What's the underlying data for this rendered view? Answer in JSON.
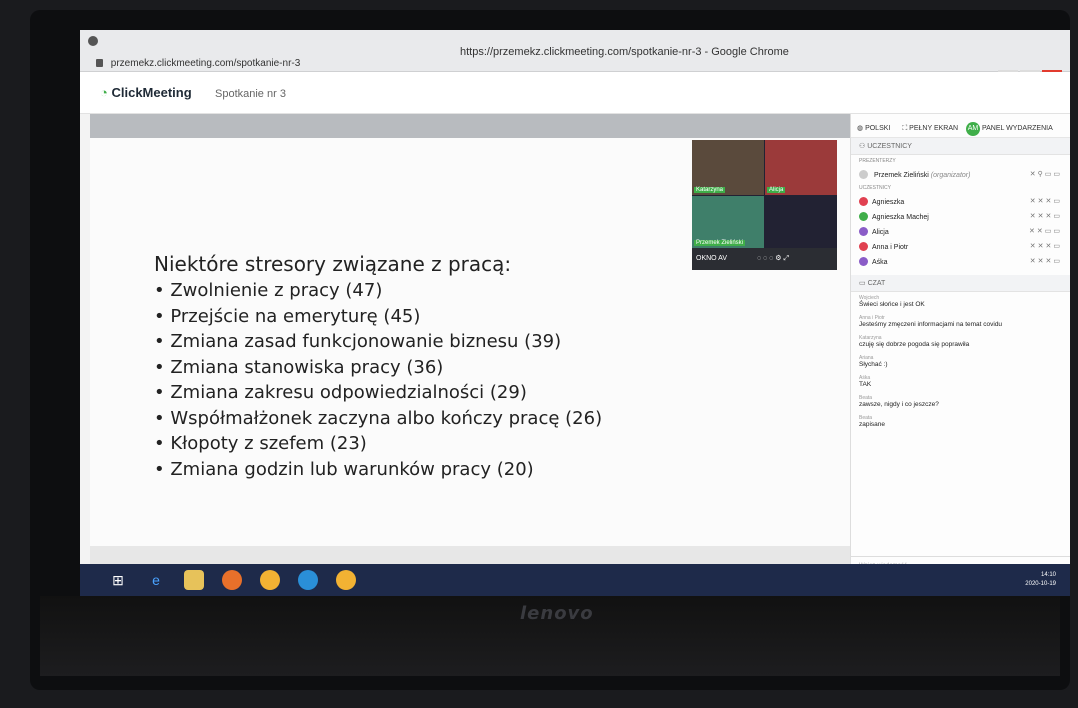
{
  "browser": {
    "title": "https://przemekz.clickmeeting.com/spotkanie-nr-3 - Google Chrome",
    "url": "przemekz.clickmeeting.com/spotkanie-nr-3"
  },
  "app": {
    "logo": "ClickMeeting",
    "meeting_name": "Spotkanie nr 3",
    "header_actions": {
      "language": "POLSKI",
      "fullscreen": "PEŁNY EKRAN",
      "avatar": "AM",
      "event_panel": "PANEL WYDARZENIA"
    }
  },
  "slide": {
    "title": "Niektóre stresory związane z pracą:",
    "bullets": [
      "Zwolnienie z pracy (47)",
      "Przejście na emeryturę (45)",
      "Zmiana zasad funkcjonowanie biznesu (39)",
      "Zmiana stanowiska pracy (36)",
      "Zmiana zakresu odpowiedzialności (29)",
      "Współmałżonek zaczyna albo kończy pracę (26)",
      "Kłopoty z szefem (23)",
      "Zmiana godzin lub warunków pracy (20)"
    ]
  },
  "video": {
    "tiles": [
      "Katarzyna",
      "Alicja",
      "Przemek Zieliński"
    ],
    "bar_label": "OKNO AV"
  },
  "participants": {
    "header": "UCZESTNICY",
    "presenters_label": "PREZENTERZY",
    "presenter": "Przemek Zieliński",
    "presenter_role": "(organizator)",
    "attendees_label": "UCZESTNICY",
    "items": [
      {
        "name": "Agnieszka",
        "color": "#e04050"
      },
      {
        "name": "Agnieszka Machej",
        "color": "#3fae49"
      },
      {
        "name": "Alicja",
        "color": "#8a5cc7"
      },
      {
        "name": "Anna i Piotr",
        "color": "#e04050"
      },
      {
        "name": "Aśka",
        "color": "#8a5cc7"
      }
    ]
  },
  "chat": {
    "header": "CZAT",
    "messages": [
      {
        "who": "Wojciech",
        "text": "Świeci słońce i jest OK"
      },
      {
        "who": "Anna i Piotr",
        "text": "Jesteśmy zmęczeni informacjami na temat covidu"
      },
      {
        "who": "Katarzyna",
        "text": "czuję się dobrze pogoda się poprawiła"
      },
      {
        "who": "Ariana",
        "text": "Słychać :)"
      },
      {
        "who": "Aśka",
        "text": "TAK"
      },
      {
        "who": "Beata",
        "text": "zawsze, nigdy i co jeszcze?"
      },
      {
        "who": "Beata",
        "text": "zapisane"
      }
    ],
    "input_placeholder": "Wpisz wiadomość"
  },
  "taskbar": {
    "time": "14:10",
    "date": "2020-10-19"
  },
  "monitor": {
    "brand": "lenovo"
  }
}
